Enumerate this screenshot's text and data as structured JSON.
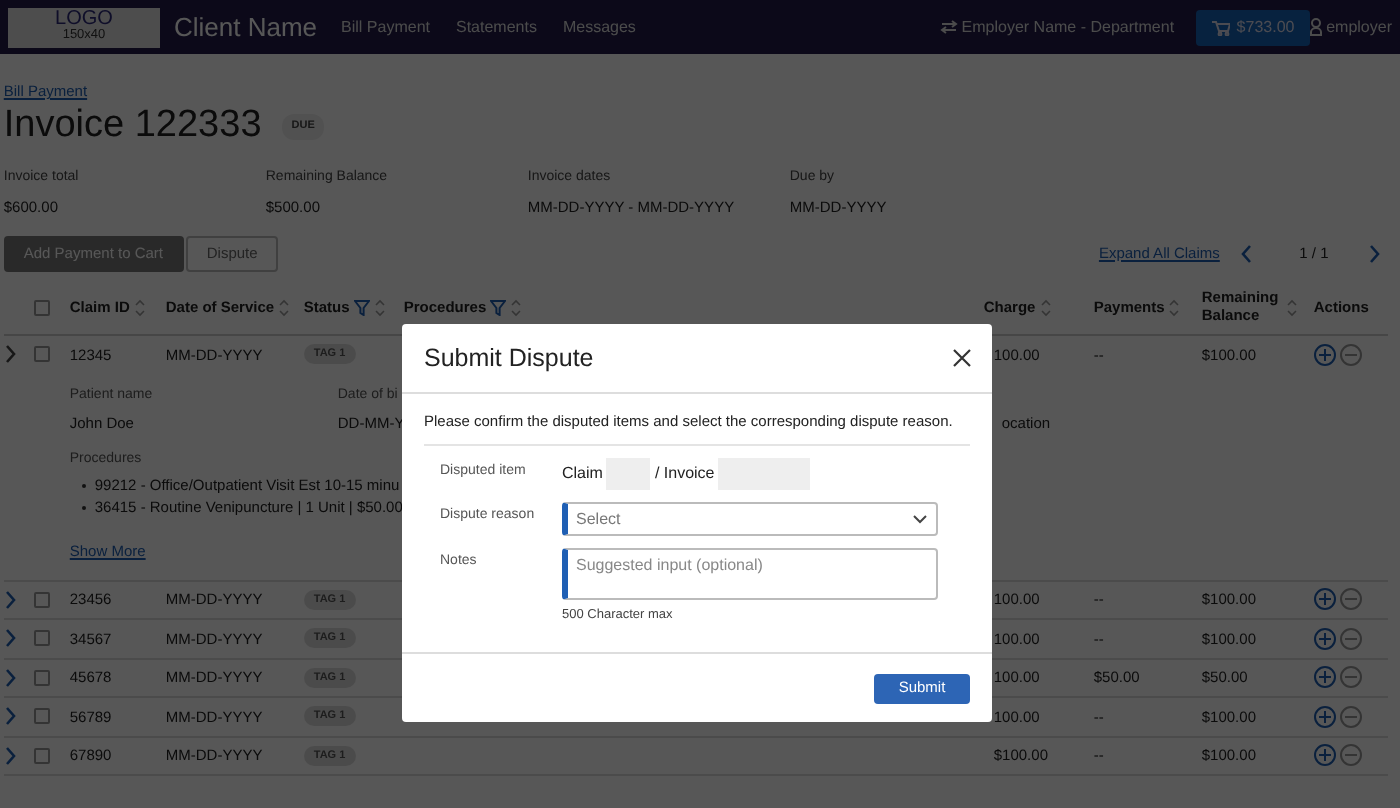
{
  "navbar": {
    "logo": {
      "text": "LOGO",
      "size": "150x40"
    },
    "client_name": "Client Name",
    "links": [
      {
        "label": "Bill Payment"
      },
      {
        "label": "Statements"
      },
      {
        "label": "Messages"
      }
    ],
    "account_switch": "Employer Name - Department",
    "cart": "$733.00",
    "user": "employer"
  },
  "breadcrumb": "Bill Payment",
  "title": "Invoice 122333",
  "status_badge": "DUE",
  "summary": [
    {
      "label": "Invoice total",
      "value": "$600.00"
    },
    {
      "label": "Remaining Balance",
      "value": "$500.00"
    },
    {
      "label": "Invoice dates",
      "value": "MM-DD-YYYY - MM-DD-YYYY"
    },
    {
      "label": "Due by",
      "value": "MM-DD-YYYY"
    }
  ],
  "buttons": [
    {
      "label": "Add Payment to Cart",
      "kind": "filled"
    },
    {
      "label": "Dispute",
      "kind": "outline"
    }
  ],
  "pagination": {
    "expand_all": "Expand All Claims",
    "page": "1 / 1"
  },
  "table": {
    "select_all_checked": false,
    "columns": [
      {
        "label": "Claim ID",
        "filter": false,
        "sortable": true
      },
      {
        "label": "Date of Service",
        "filter": false,
        "sortable": true
      },
      {
        "label": "Status",
        "filter": true,
        "sortable": true
      },
      {
        "label": "Procedures",
        "filter": true,
        "sortable": true
      },
      {
        "label": "Charge",
        "filter": false,
        "sortable": true
      },
      {
        "label": "Payments",
        "filter": false,
        "sortable": true
      },
      {
        "label": "Remaining Balance",
        "filter": false,
        "sortable": true
      },
      {
        "label": "Actions",
        "filter": false,
        "sortable": false
      }
    ],
    "rows": [
      {
        "claim_id": "12345",
        "date": "MM-DD-YYYY",
        "status": "TAG 1",
        "charge": "100.00",
        "payments": "--",
        "remaining": "$100.00",
        "checked": false,
        "expanded": true,
        "details": {
          "patient_label": "Patient name",
          "patient": "John Doe",
          "dob_label": "Date of bi",
          "dob": "DD-MM-Y",
          "location": "ocation",
          "procedures_label": "Procedures",
          "procedures": [
            "99212 - Office/Outpatient Visit Est 10-15 minu",
            "36415 - Routine Venipuncture | 1 Unit | $50.00"
          ],
          "show_more": "Show More"
        }
      },
      {
        "claim_id": "23456",
        "date": "MM-DD-YYYY",
        "status": "TAG 1",
        "charge": "100.00",
        "payments": "--",
        "remaining": "$100.00",
        "checked": false,
        "expanded": false
      },
      {
        "claim_id": "34567",
        "date": "MM-DD-YYYY",
        "status": "TAG 1",
        "charge": "100.00",
        "payments": "--",
        "remaining": "$100.00",
        "checked": false,
        "expanded": false
      },
      {
        "claim_id": "45678",
        "date": "MM-DD-YYYY",
        "status": "TAG 1",
        "charge": "100.00",
        "payments": "$50.00",
        "remaining": "$50.00",
        "checked": false,
        "expanded": false
      },
      {
        "claim_id": "56789",
        "date": "MM-DD-YYYY",
        "status": "TAG 1",
        "charge": "100.00",
        "payments": "--",
        "remaining": "$100.00",
        "checked": false,
        "expanded": false
      },
      {
        "claim_id": "67890",
        "date": "MM-DD-YYYY",
        "status": "TAG 1",
        "charge": "$100.00",
        "payments": "--",
        "remaining": "$100.00",
        "checked": false,
        "expanded": false
      }
    ]
  },
  "modal": {
    "title": "Submit Dispute",
    "message": "Please confirm the disputed items and select the corresponding dispute reason.",
    "fields": [
      {
        "kind": "item",
        "label": "Disputed item",
        "parts": [
          "Claim",
          "/ Invoice"
        ]
      },
      {
        "kind": "select",
        "label": "Dispute reason",
        "placeholder": "Select"
      },
      {
        "kind": "textarea",
        "label": "Notes",
        "placeholder": "Suggested input (optional)",
        "hint": "500 Character max"
      }
    ],
    "submit": "Submit"
  }
}
